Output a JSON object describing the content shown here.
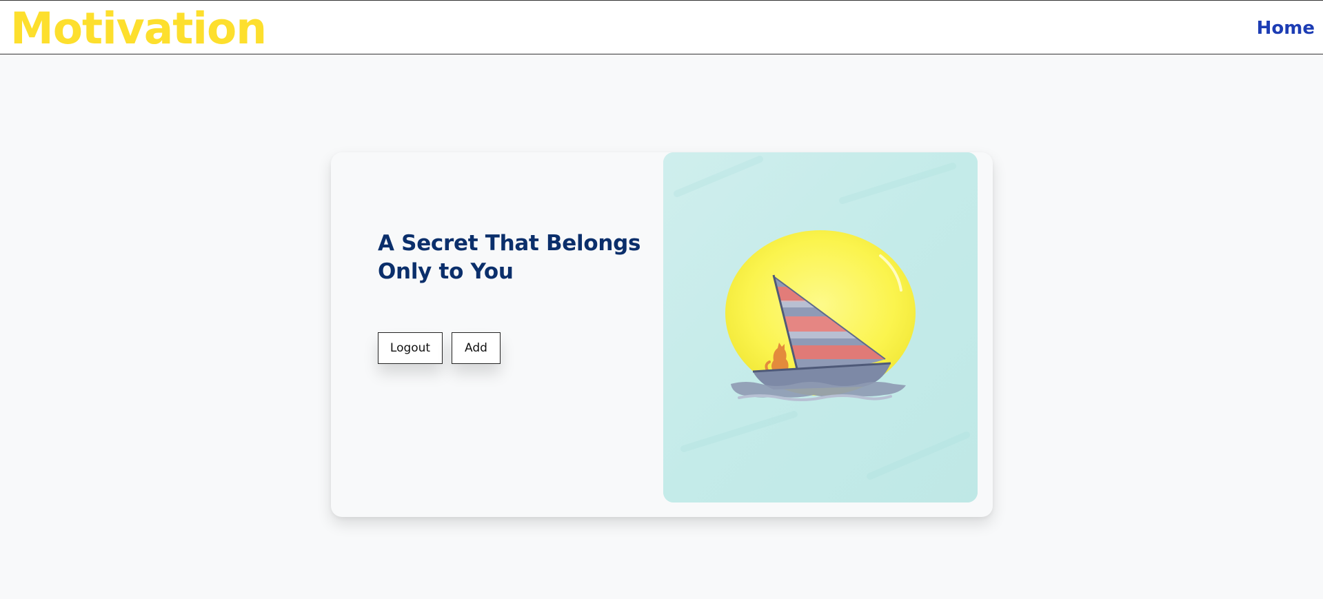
{
  "navbar": {
    "brand": "Motivation",
    "home_link": "Home",
    "brand_color": "#fddf2d",
    "link_color": "#1d3db4"
  },
  "card": {
    "title": "A Secret That Belongs Only to You",
    "title_color": "#0b2f6b",
    "buttons": {
      "logout": "Logout",
      "add": "Add"
    },
    "illustration": {
      "icon": "sailboat-with-fox-illustration",
      "background_color": "#c6ecea",
      "sun_color": "#fbf452",
      "sail_stripe_colors": [
        "#e07a77",
        "#8e99b5"
      ]
    }
  }
}
